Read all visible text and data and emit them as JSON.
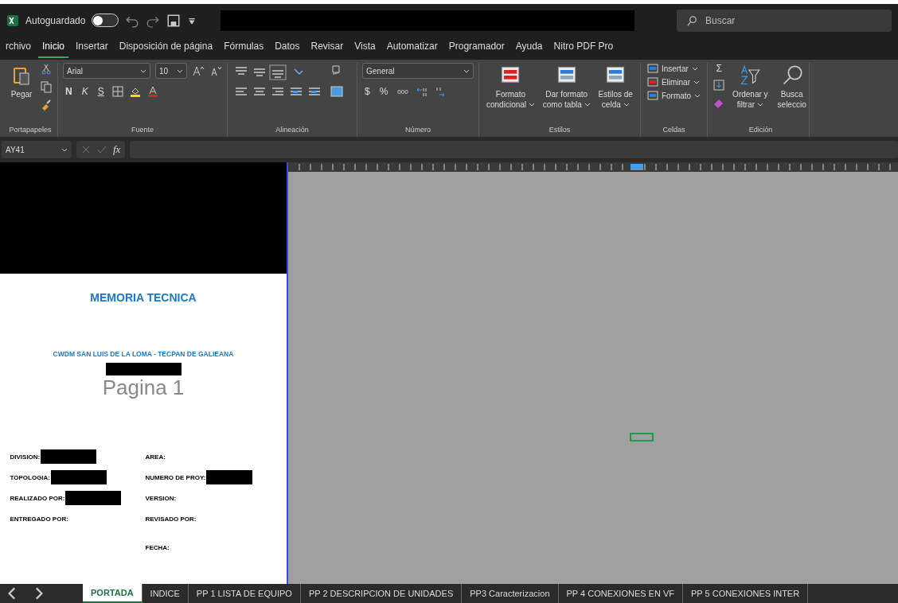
{
  "title_bar": {
    "autosave_label": "Autoguardado",
    "autosave_on": false,
    "title_redacted": true,
    "search": {
      "placeholder": "Buscar"
    }
  },
  "menu_tabs": [
    {
      "label": "rchivo",
      "selected": false
    },
    {
      "label": "Inicio",
      "selected": true
    },
    {
      "label": "Insertar",
      "selected": false
    },
    {
      "label": "Disposición de página",
      "selected": false
    },
    {
      "label": "Fórmulas",
      "selected": false
    },
    {
      "label": "Datos",
      "selected": false
    },
    {
      "label": "Revisar",
      "selected": false
    },
    {
      "label": "Vista",
      "selected": false
    },
    {
      "label": "Automatizar",
      "selected": false
    },
    {
      "label": "Programador",
      "selected": false
    },
    {
      "label": "Ayuda",
      "selected": false
    },
    {
      "label": "Nitro PDF Pro",
      "selected": false
    }
  ],
  "ribbon": {
    "clipboard": {
      "paste": "Pegar",
      "label": "Portapapeles"
    },
    "font": {
      "family": "Arial",
      "size": "10",
      "bold": "N",
      "italic": "K",
      "underline": "S",
      "label": "Fuente"
    },
    "alignment": {
      "label": "Alineación"
    },
    "number": {
      "format": "General",
      "currency": "$",
      "percent": "%",
      "thousands": "000",
      "label": "Número"
    },
    "styles": {
      "buttons": [
        [
          "Formato",
          "condicional"
        ],
        [
          "Dar formato",
          "como tabla"
        ],
        [
          "Estilos de",
          "celda"
        ]
      ],
      "label": "Estilos"
    },
    "cells": {
      "buttons": [
        "Insertar",
        "Eliminar",
        "Formato"
      ],
      "label": "Celdas"
    },
    "editing": {
      "sum": "Σ",
      "sort": [
        "Ordenar y",
        "filtrar"
      ],
      "find": [
        "Busca",
        "seleccio"
      ],
      "label": "Edición"
    }
  },
  "formula_bar": {
    "name_box": "AY41",
    "fx": "fx"
  },
  "cover": {
    "top_redacted": true,
    "title": "MEMORIA TECNICA",
    "subtitle": "CWDM SAN LUIS DE LA LOMA - TECPAN DE GALIEANA",
    "watermark": "Pagina 1",
    "fields": [
      {
        "label": "DIVISION:",
        "redacted": true
      },
      {
        "label": "AREA:",
        "redacted": false
      },
      {
        "label": "TOPOLOGIA:",
        "redacted": true
      },
      {
        "label": "NUMERO DE PROY:",
        "redacted": true
      },
      {
        "label": "REALIZADO POR:",
        "redacted": true
      },
      {
        "label": "VERSION:",
        "redacted": false
      },
      {
        "label": "ENTREGADO POR:",
        "redacted": false
      },
      {
        "label": "REVISADO POR:",
        "redacted": false
      },
      {
        "label": "FECHA:",
        "redacted": false
      }
    ]
  },
  "sheet_tabs": [
    {
      "label": "PORTADA",
      "selected": true
    },
    {
      "label": "INDICE",
      "selected": false
    },
    {
      "label": "PP 1 LISTA DE EQUIPO",
      "selected": false
    },
    {
      "label": "PP 2 DESCRIPCION DE UNIDADES",
      "selected": false
    },
    {
      "label": "PP3 Caracterizacion",
      "selected": false
    },
    {
      "label": "PP 4 CONEXIONES EN VF",
      "selected": false
    },
    {
      "label": "PP 5 CONEXIONES INTER",
      "selected": false
    }
  ]
}
